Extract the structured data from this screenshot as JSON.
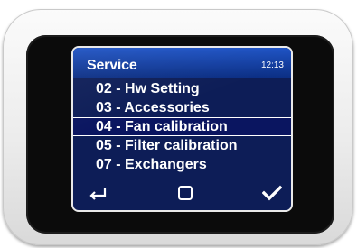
{
  "screen": {
    "title": "Service",
    "clock": "12:13"
  },
  "menu": {
    "items": [
      {
        "label": "02 - Hw Setting"
      },
      {
        "label": "03 - Accessories"
      },
      {
        "label": "04 - Fan calibration",
        "selected": true
      },
      {
        "label": "05 - Filter calibration"
      },
      {
        "label": "07 - Exchangers"
      }
    ]
  },
  "footer": {
    "icons": [
      "back-arrow-icon",
      "home-square-icon",
      "checkmark-icon"
    ]
  },
  "colors": {
    "screen_background": "#0d1d57",
    "header_gradient_top": "#1d52c4",
    "text": "#ffffff",
    "device_body": "#ececec",
    "bezel": "#0b0b0b"
  }
}
